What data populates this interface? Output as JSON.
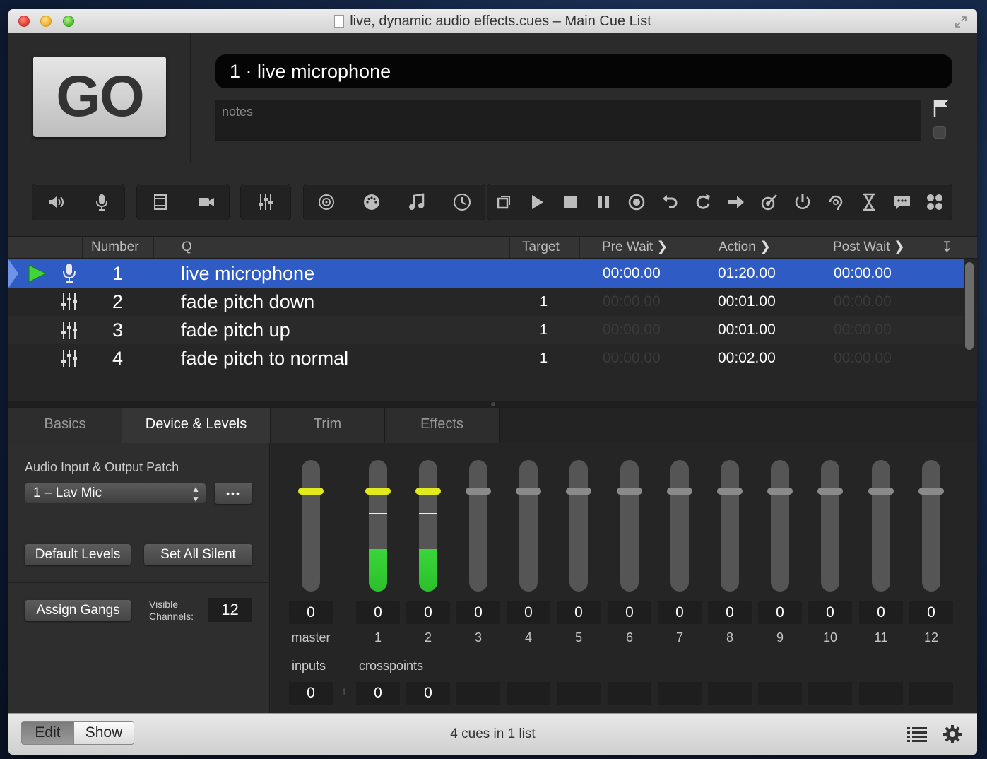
{
  "window": {
    "title": "live, dynamic audio effects.cues – Main Cue List"
  },
  "go": {
    "label": "GO"
  },
  "cue_name": "1 · live microphone",
  "notes_placeholder": "notes",
  "columns": {
    "number": "Number",
    "q": "Q",
    "target": "Target",
    "pre_wait": "Pre Wait",
    "action": "Action",
    "post_wait": "Post Wait"
  },
  "cues": [
    {
      "number": "1",
      "name": "live microphone",
      "target": "",
      "pre_wait": "00:00.00",
      "action": "01:20.00",
      "post_wait": "00:00.00",
      "type": "mic-icon"
    },
    {
      "number": "2",
      "name": "fade pitch down",
      "target": "1",
      "pre_wait": "00:00.00",
      "action": "00:01.00",
      "post_wait": "00:00.00",
      "type": "fader-icon"
    },
    {
      "number": "3",
      "name": "fade pitch up",
      "target": "1",
      "pre_wait": "00:00.00",
      "action": "00:01.00",
      "post_wait": "00:00.00",
      "type": "fader-icon"
    },
    {
      "number": "4",
      "name": "fade pitch to normal",
      "target": "1",
      "pre_wait": "00:00.00",
      "action": "00:02.00",
      "post_wait": "00:00.00",
      "type": "fader-icon"
    }
  ],
  "tabs": [
    "Basics",
    "Device & Levels",
    "Trim",
    "Effects"
  ],
  "active_tab": "Device & Levels",
  "inspector": {
    "patch_label": "Audio Input & Output Patch",
    "patch_value": "1 – Lav Mic",
    "more_label": "•••",
    "default_levels": "Default Levels",
    "set_all_silent": "Set All Silent",
    "assign_gangs": "Assign Gangs",
    "visible_channels_label_1": "Visible",
    "visible_channels_label_2": "Channels:",
    "visible_channels": "12"
  },
  "levels": {
    "channels": [
      "master",
      "1",
      "2",
      "3",
      "4",
      "5",
      "6",
      "7",
      "8",
      "9",
      "10",
      "11",
      "12"
    ],
    "values": [
      "0",
      "0",
      "0",
      "0",
      "0",
      "0",
      "0",
      "0",
      "0",
      "0",
      "0",
      "0",
      "0"
    ],
    "inputs_label": "inputs",
    "crosspoints_label": "crosspoints",
    "input_row_label": "1",
    "input_value": "0",
    "crosspoint_values": [
      "0",
      "0"
    ]
  },
  "bottom": {
    "edit": "Edit",
    "show": "Show",
    "status": "4 cues in 1 list"
  },
  "colors": {
    "selection": "#2f5cc4",
    "fader_yellow": "#e2ea1e",
    "meter_green": "#3ad63a"
  }
}
